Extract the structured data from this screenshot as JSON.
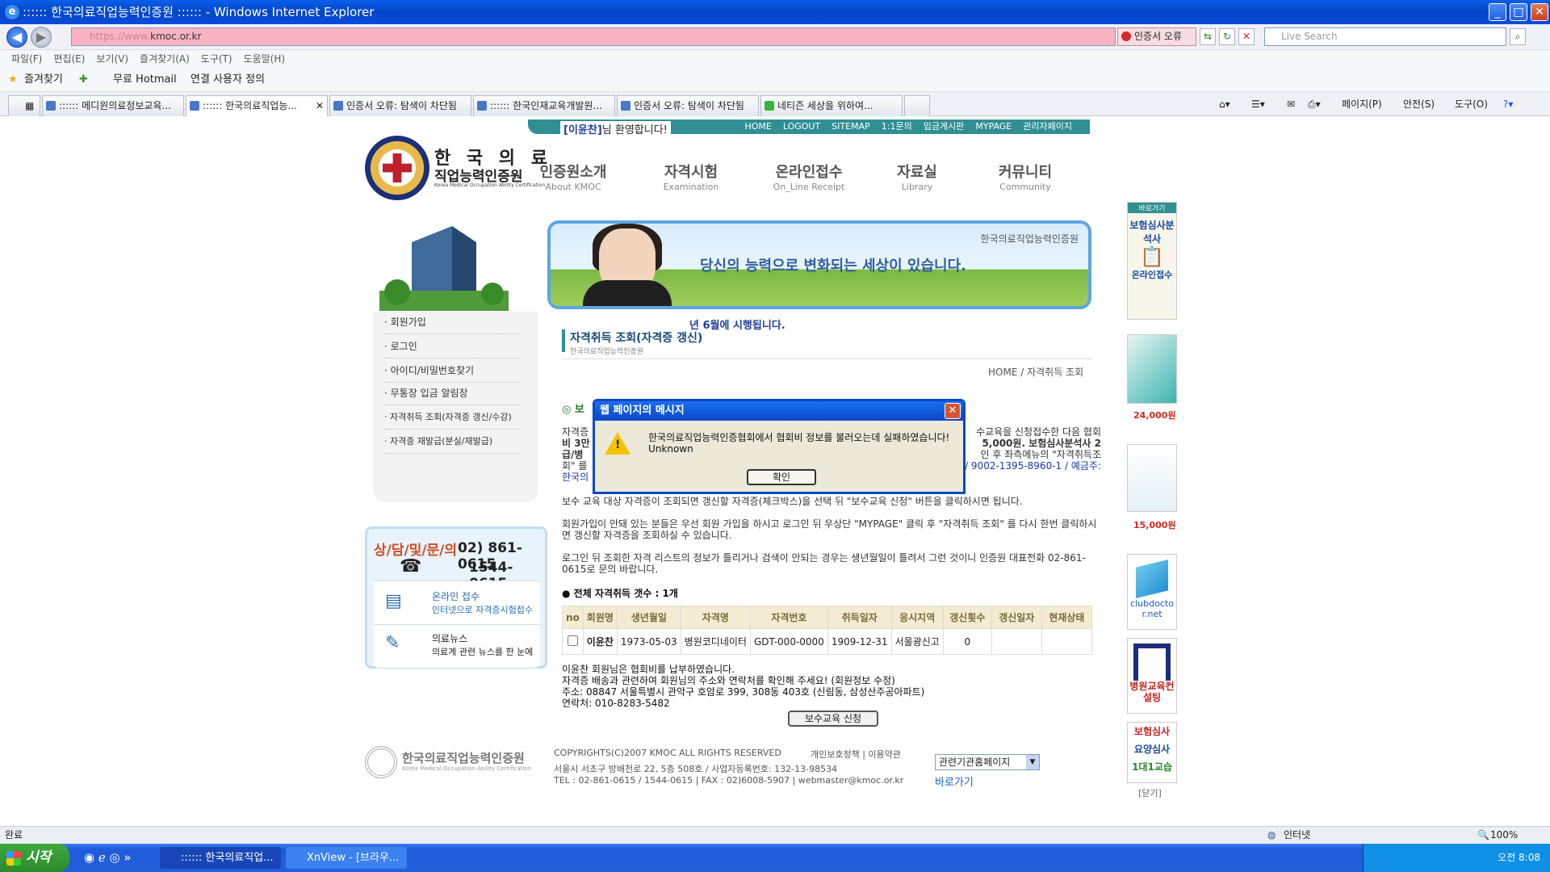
{
  "window": {
    "title": ":::::: 한국의료직업능력인증원 :::::: - Windows Internet Explorer"
  },
  "address": {
    "prefix": "https://www.",
    "domain": "kmoc.or.kr",
    "cert_error": "인증서 오류",
    "search_placeholder": "Live Search"
  },
  "menu": [
    "파일(F)",
    "편집(E)",
    "보기(V)",
    "즐겨찾기(A)",
    "도구(T)",
    "도움말(H)"
  ],
  "favorites": {
    "label": "즐겨찾기",
    "items": [
      "무료 Hotmail",
      "연결 사용자 정의"
    ]
  },
  "tabs": [
    ":::::: 메디윈의료정보교육...",
    ":::::: 한국의료직업능...",
    "인증서 오류: 탐색이 차단됨",
    ":::::: 한국인재교육개발원...",
    "인증서 오류: 탐색이 차단됨",
    "네티즌 세상을 위하여..."
  ],
  "commandbar": [
    "페이지(P)",
    "안전(S)",
    "도구(O)"
  ],
  "site": {
    "welcome_name": "[이윤찬]",
    "welcome_text": "님 환영합니다!",
    "topnav": [
      "HOME",
      "LOGOUT",
      "SITEMAP",
      "1:1문의",
      "입금게시판",
      "MYPAGE",
      "관리자페이지"
    ],
    "brand_line1": "한 국 의 료",
    "brand_line2": "직업능력인증원",
    "brand_en": "Korea Medical Occupation Ability Certification",
    "mainnav": [
      {
        "k": "인증원소개",
        "e": "About KMOC"
      },
      {
        "k": "자격시험",
        "e": "Examination"
      },
      {
        "k": "온라인접수",
        "e": "On_Line Receipt"
      },
      {
        "k": "자료실",
        "e": "Library"
      },
      {
        "k": "커뮤니티",
        "e": "Community"
      }
    ],
    "banner_text": "당신의 능력으로 변화되는 세상이 있습니다.",
    "banner_org": "한국의료직업능력인증원",
    "notice": "년 6월에 시행됩니다.",
    "sidemenu": [
      "회원가입",
      "로그인",
      "아이디/비밀번호찾기",
      "무통장 입금 알림장",
      "자격취득 조회(자격증 갱신/수강)",
      "자격증 재발급(분실/재발급)"
    ],
    "counsel": {
      "title": "상/담/및/문/의",
      "phone1": "02) 861-0615",
      "phone2": "1544-0615",
      "online_title": "온라인 접수",
      "online_sub": "인터넷으로 자격증시험접수",
      "news_title": "의료뉴스",
      "news_sub": "의료계 관련 뉴스를 한 눈에"
    },
    "page_title": "자격취득 조회(자격증 갱신)",
    "page_sub": "한국의료직업능력인증원",
    "breadcrumb": "HOME / 자격취득 조회",
    "section_marker": "◎ 보",
    "para_a1": "자격증",
    "para_a2": "수교육을 신청접수한 다음 협회",
    "para_a3": "비 3만",
    "para_a4": "5,000원. 보험심사분석사 2",
    "para_a5": "급/병",
    "para_a6": "인 후 좌측메뉴의 \"자격취득조",
    "para_a7": "회\" 를",
    "para_a8": "/ 9002-1395-8960-1 / 예금주:",
    "para_a9": "한국의",
    "para1": "보수 교육 대상 자격증이 조회되면 갱신할 자격증(체크박스)을 선택 뒤 \"보수교육 신청\" 버튼을 클릭하시면 됩니다.",
    "para2": "회원가입이 안돼 있는 분들은 우선 회원 가입을 하시고 로그인 뒤 우상단 \"MYPAGE\" 클릭 후 \"자격취득 조회\" 를 다시 한번 클릭하시면 갱신할 자격증을 조회하실 수 있습니다.",
    "para3": "로그인 뒤 조회한 자격 리스트의 정보가 틀리거나 검색이 안되는 경우는 생년월일이 틀려서 그런 것이니 인증원 대표전화 02-861-0615로 문의 바랍니다.",
    "count_label": "● 전체 자격취득 갯수 : 1개",
    "table": {
      "headers": [
        "no",
        "회원명",
        "생년월일",
        "자격명",
        "자격번호",
        "취득일자",
        "응시지역",
        "갱신횟수",
        "갱신일자",
        "현재상태"
      ],
      "rows": [
        [
          "",
          "이윤찬",
          "1973-05-03",
          "병원코디네이터",
          "GDT-000-0000",
          "1909-12-31",
          "서울광신고",
          "0",
          "",
          ""
        ]
      ]
    },
    "member_note": "이윤찬 회원님은 협회비를 납부하였습니다.",
    "delivery_note": "자격증 배송과 관련하여 회원님의 주소와 연락처를 확인해 주세요! (회원정보 수정)",
    "address_line": "주소: 08847 서울특별시 관악구 호암로 399, 308동 403호 (신림동, 삼성산주공아파트)",
    "contact_line": "연락처: 010-8283-5482",
    "apply_button": "보수교육 신청",
    "footer": {
      "copyright": "COPYRIGHTS(C)2007 KMOC ALL RIGHTS RESERVED",
      "links": "개인보호정책 | 이용약관",
      "address": "서울시 서초구 방배천로 22, 5층 508호 / 사업자등록번호: 132-13-98534",
      "contact": "TEL : 02-861-0615 / 1544-0615 | FAX : 02)6008-5907 | webmaster@kmoc.or.kr",
      "logo_text": "한국의료직업능력인증원",
      "logo_en": "Korea Medical Occupation Ability Certification",
      "select": "관련기관홈페이지",
      "go": "바로가기"
    },
    "right": {
      "shortcut": "바로가기",
      "ad1": "보험심사분석사",
      "ad1b": "온라인접수",
      "price1": "24,000원",
      "price2": "15,000원",
      "ad3": "clubdoctor.net",
      "ad4": "병원교육컨설팅",
      "ad5a": "보험심사",
      "ad5b": "요양심사",
      "ad5c": "1대1교습",
      "close": "[닫기]"
    }
  },
  "dialog": {
    "title": "웹 페이지의 메시지",
    "message": "한국의료직업능력인증협회에서 협회비 정보를 불러오는데 실패하였습니다!",
    "detail": "Unknown",
    "ok": "확인"
  },
  "status": {
    "left": "완료",
    "zone": "인터넷",
    "zoom": "100%"
  },
  "taskbar": {
    "start": "시작",
    "tasks": [
      ":::::: 한국의료직업...",
      "XnView - [브라우..."
    ],
    "clock": "오전 8:08"
  },
  "colors": {
    "titlebar": "#0a5fe8",
    "address_error": "#f9b3c2",
    "teal": "#2f8f93",
    "dialog_border": "#0a48c8"
  }
}
